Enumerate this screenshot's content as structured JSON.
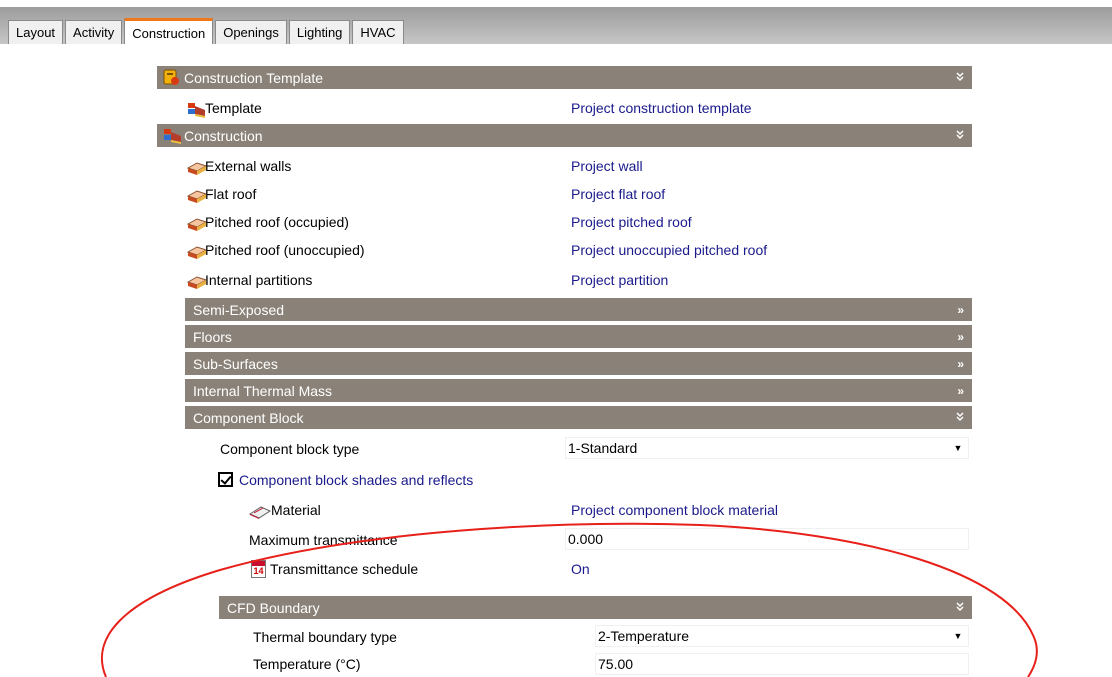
{
  "tabs": [
    "Layout",
    "Activity",
    "Construction",
    "Openings",
    "Lighting",
    "HVAC"
  ],
  "active_tab": "Construction",
  "construction_template": {
    "header": "Construction Template",
    "template_label": "Template",
    "template_value": "Project construction template"
  },
  "construction": {
    "header": "Construction",
    "items": [
      {
        "label": "External walls",
        "value": "Project wall"
      },
      {
        "label": "Flat roof",
        "value": "Project flat roof"
      },
      {
        "label": "Pitched roof (occupied)",
        "value": "Project pitched roof"
      },
      {
        "label": "Pitched roof (unoccupied)",
        "value": "Project unoccupied pitched roof"
      },
      {
        "label": "Internal partitions",
        "value": "Project partition"
      }
    ]
  },
  "sections": {
    "semi_exposed": "Semi-Exposed",
    "floors": "Floors",
    "sub_surfaces": "Sub-Surfaces",
    "internal_thermal_mass": "Internal Thermal Mass",
    "component_block": "Component Block",
    "cfd_boundary": "CFD Boundary"
  },
  "component_block": {
    "type_label": "Component block type",
    "type_value": "1-Standard",
    "shades_label": "Component block shades and reflects",
    "shades_checked": true,
    "material_label": "Material",
    "material_value": "Project component block material",
    "max_trans_label": "Maximum transmittance",
    "max_trans_value": "0.000",
    "trans_schedule_label": "Transmittance schedule",
    "trans_schedule_value": "On",
    "calendar_number": "14"
  },
  "cfd_boundary": {
    "thermal_type_label": "Thermal boundary type",
    "thermal_type_value": "2-Temperature",
    "temperature_label": "Temperature (°C)",
    "temperature_value": "75.00"
  },
  "glyphs": {
    "collapse": "»",
    "expand": "»",
    "dropdown": "▼"
  },
  "colors": {
    "header_bg": "#8a8278",
    "value_text": "#1a1a8c",
    "active_tab_accent": "#f07818",
    "annotation_ellipse": "#e8201a"
  }
}
